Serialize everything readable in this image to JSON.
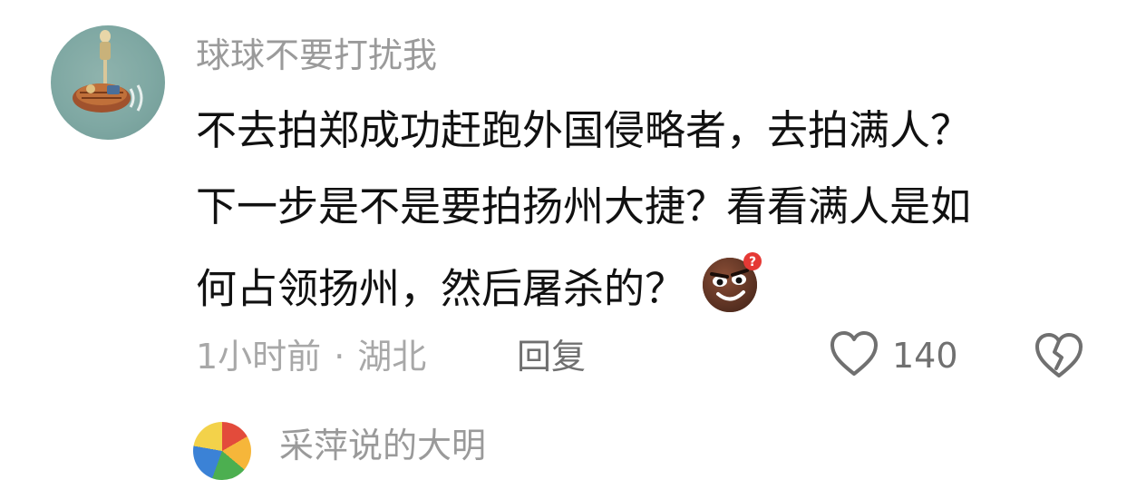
{
  "comment": {
    "username": "球球不要打扰我",
    "text_lines": [
      "不去拍郑成功赶跑外国侵略者，去拍满人？",
      "下一步是不是要拍扬州大捷？看看满人是如",
      "何占领扬州，然后屠杀的？"
    ],
    "emoji_icon": "smirk-face-emoji",
    "time": "1小时前",
    "separator": "·",
    "location": "湖北",
    "reply_label": "回复",
    "like_count": "140",
    "like_icon": "heart-outline-icon",
    "dislike_icon": "broken-heart-icon"
  },
  "next_comment": {
    "username": "采萍说的大明"
  },
  "colors": {
    "text_primary": "#111111",
    "text_secondary": "#9a9a9a",
    "icon_gray": "#707070",
    "avatar_bg": "#7fa8a3"
  }
}
